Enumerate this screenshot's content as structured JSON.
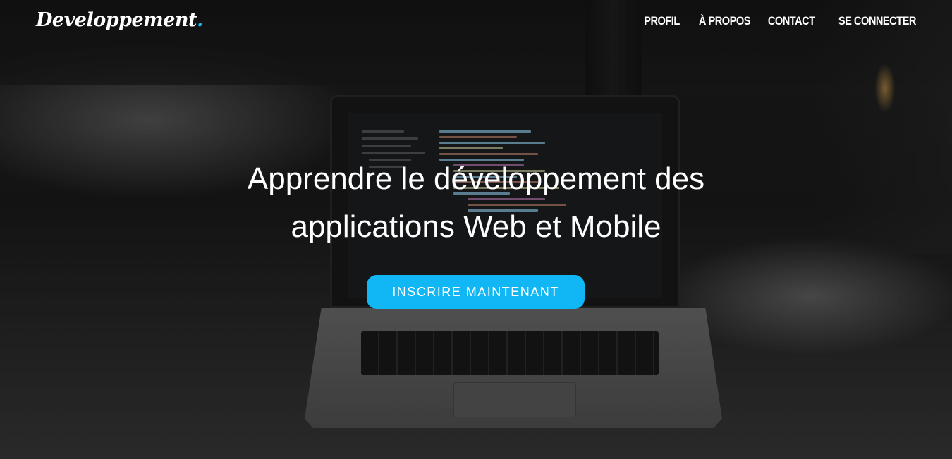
{
  "brand": {
    "name": "Developpement",
    "dot": ".",
    "accent_color": "#11b7f5"
  },
  "nav": {
    "items": [
      {
        "label": "PROFIL"
      },
      {
        "label": "À PROPOS"
      },
      {
        "label": "CONTACT"
      },
      {
        "label": "SE CONNECTER"
      }
    ]
  },
  "hero": {
    "title_line1": "Apprendre le développement des",
    "title_line2": "applications Web et Mobile",
    "cta_label": "INSCRIRE MAINTENANT",
    "cta_color": "#11b7f5"
  }
}
